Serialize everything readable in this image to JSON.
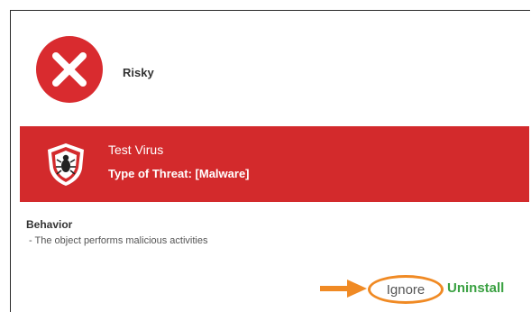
{
  "status": {
    "icon": "red-x-circle-icon",
    "label": "Risky"
  },
  "threat": {
    "icon": "shield-bug-icon",
    "name": "Test Virus",
    "type_label": "Type of Threat: [Malware]"
  },
  "behavior": {
    "heading": "Behavior",
    "items": [
      "- The object performs malicious activities"
    ]
  },
  "actions": {
    "pointer_icon": "arrow-right-icon",
    "ignore_label": "Ignore",
    "uninstall_label": "Uninstall"
  },
  "colors": {
    "danger": "#d92b2f",
    "banner": "#d32a2c",
    "highlight": "#f08a24",
    "uninstall": "#3aa142"
  }
}
